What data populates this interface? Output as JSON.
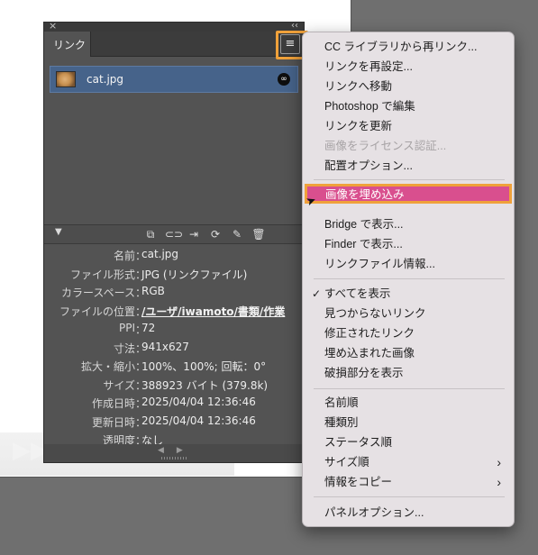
{
  "panel": {
    "close_glyph": "×",
    "collapse_glyph": "‹‹",
    "tab_label": "リンク",
    "menu_button_glyph": "≡",
    "link_item": {
      "name": "cat.jpg",
      "status_glyph": "∞"
    },
    "toolbar": {
      "toggle_glyph": "▼",
      "icons": [
        "relink-cc-icon",
        "relink-icon",
        "goto-link-icon",
        "update-link-icon",
        "edit-original-icon",
        "delete-icon"
      ]
    },
    "info": [
      {
        "label": "名前",
        "value": "cat.jpg"
      },
      {
        "label": "ファイル形式",
        "value": "JPG (リンクファイル)"
      },
      {
        "label": "カラースペース",
        "value": "RGB"
      },
      {
        "label": "ファイルの位置",
        "value": "/ユーザ/iwamoto/書類/作業"
      },
      {
        "label": "PPI",
        "value": "72"
      },
      {
        "label": "寸法",
        "value": "941x627"
      },
      {
        "label": "拡大・縮小",
        "value": "100%、100%; 回転：0°"
      },
      {
        "label": "サイズ",
        "value": "388923 バイト (379.8k)"
      },
      {
        "label": "作成日時",
        "value": "2025/04/04 12:36:46"
      },
      {
        "label": "更新日時",
        "value": "2025/04/04 12:36:46"
      },
      {
        "label": "透明度",
        "value": "なし"
      }
    ],
    "colon": "："
  },
  "menu": {
    "items": [
      {
        "label": "CC ライブラリから再リンク...",
        "enabled": true
      },
      {
        "label": "リンクを再設定...",
        "enabled": true
      },
      {
        "label": "リンクへ移動",
        "enabled": true
      },
      {
        "label": "Photoshop で編集",
        "enabled": true
      },
      {
        "label": "リンクを更新",
        "enabled": true
      },
      {
        "label": "画像をライセンス認証...",
        "enabled": false
      },
      {
        "label": "配置オプション...",
        "enabled": true
      },
      {
        "label": "画像を埋め込み",
        "enabled": true,
        "highlighted": true
      },
      {
        "label": "Bridge で表示...",
        "enabled": true
      },
      {
        "label": "Finder で表示...",
        "enabled": true
      },
      {
        "label": "リンクファイル情報...",
        "enabled": true
      },
      {
        "label": "すべてを表示",
        "enabled": true,
        "checked": true
      },
      {
        "label": "見つからないリンク",
        "enabled": true
      },
      {
        "label": "修正されたリンク",
        "enabled": true
      },
      {
        "label": "埋め込まれた画像",
        "enabled": true
      },
      {
        "label": "破損部分を表示",
        "enabled": true
      },
      {
        "label": "名前順",
        "enabled": true
      },
      {
        "label": "種類別",
        "enabled": true
      },
      {
        "label": "ステータス順",
        "enabled": true
      },
      {
        "label": "サイズ順",
        "enabled": true,
        "submenu": true
      },
      {
        "label": "情報をコピー",
        "enabled": true,
        "submenu": true
      },
      {
        "label": "パネルオプション...",
        "enabled": true
      }
    ],
    "check_glyph": "✓",
    "submenu_glyph": "›",
    "highlight_color": "#d94f8e",
    "callout_color": "#f0a13a"
  }
}
